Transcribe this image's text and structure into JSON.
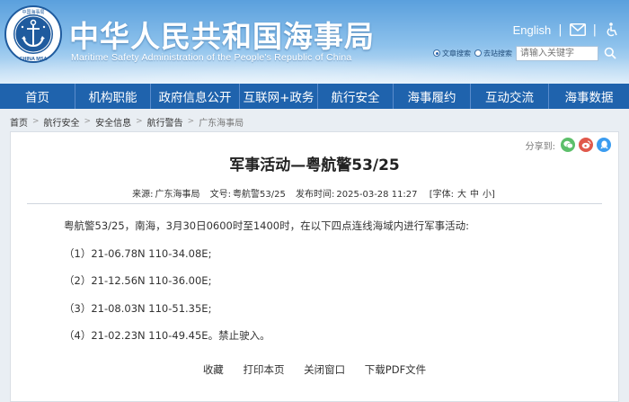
{
  "header": {
    "title_cn": "中华人民共和国海事局",
    "title_en": "Maritime Safety Administration of the People's Republic of China",
    "logo_text": "CHINA MSA",
    "english_link": "English",
    "separator": "|",
    "search": {
      "option_site": "文章搜索",
      "option_web": "去站搜索",
      "placeholder": "请输入关键字"
    }
  },
  "nav": {
    "items": [
      {
        "label": "首页"
      },
      {
        "label": "机构职能"
      },
      {
        "label": "政府信息公开"
      },
      {
        "label": "互联网+政务"
      },
      {
        "label": "航行安全"
      },
      {
        "label": "海事履约"
      },
      {
        "label": "互动交流"
      },
      {
        "label": "海事数据"
      }
    ]
  },
  "breadcrumb": [
    "首页",
    "航行安全",
    "安全信息",
    "航行警告",
    "广东海事局"
  ],
  "share": {
    "label": "分享到:"
  },
  "article": {
    "title": "军事活动—粤航警53/25",
    "source_label": "来源:",
    "source": "广东海事局",
    "docno_label": "文号:",
    "docno": "粤航警53/25",
    "date_label": "发布时间:",
    "date": "2025-03-28 11:27",
    "font_label": "[字体:",
    "font_large": "大",
    "font_medium": "中",
    "font_small": "小]",
    "paragraphs": [
      "粤航警53/25，南海，3月30日0600时至1400时，在以下四点连线海域内进行军事活动:",
      "（1）21-06.78N 110-34.08E;",
      "（2）21-12.56N 110-36.00E;",
      "（3）21-08.03N 110-51.35E;",
      "（4）21-02.23N 110-49.45E。禁止驶入。"
    ]
  },
  "actions": {
    "favorite": "收藏",
    "print": "打印本页",
    "close": "关闭窗口",
    "download": "下载PDF文件"
  },
  "colors": {
    "nav_bg": "#1f63ad",
    "wechat": "#5cbf6a",
    "weibo": "#e0584b",
    "qq": "#3b9cf0"
  }
}
